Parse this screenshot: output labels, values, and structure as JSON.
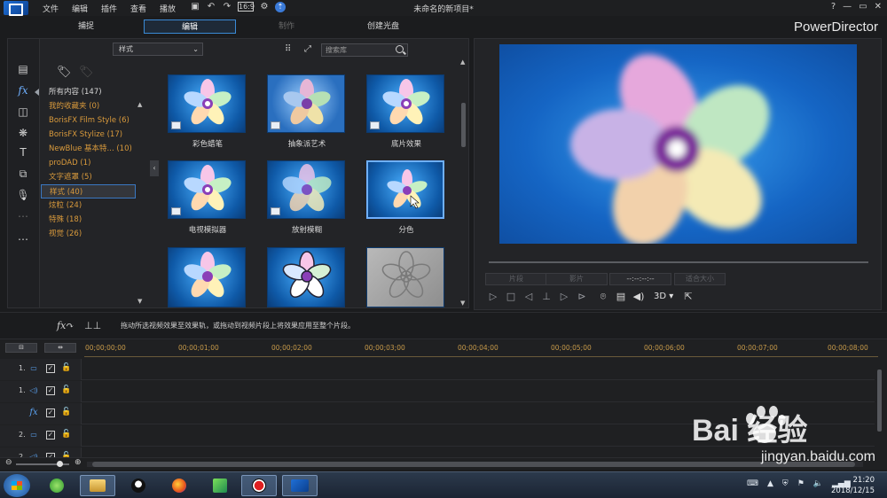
{
  "app": {
    "menu": [
      "文件",
      "编辑",
      "插件",
      "查看",
      "播放"
    ],
    "toolbar_icons": [
      "save-icon",
      "undo-icon",
      "redo-icon",
      "screen-ratio-icon",
      "settings-icon",
      "upgrade-icon"
    ],
    "document_title": "未命名的新项目*",
    "brand": "PowerDirector",
    "window_buttons": [
      "?",
      "—",
      "▭",
      "✕"
    ]
  },
  "modes": [
    {
      "label": "捕捉",
      "state": "normal"
    },
    {
      "label": "编辑",
      "state": "active"
    },
    {
      "label": "制作",
      "state": "disabled"
    },
    {
      "label": "创建光盘",
      "state": "normal"
    }
  ],
  "library": {
    "rail_icons": [
      "media-room-icon",
      "effects-fx-icon",
      "pip-icon",
      "particle-icon",
      "title-icon",
      "transition-icon",
      "audio-mix-icon",
      "chapter-icon",
      "subtitle-icon"
    ],
    "style_dropdown": "样式",
    "search_placeholder": "搜索库",
    "tag_icons": [
      "add-tag-icon",
      "remove-tag-icon"
    ],
    "categories": [
      {
        "label": "所有内容 (147)",
        "kind": "all"
      },
      {
        "label": "我的收藏夹  (0)",
        "kind": "normal"
      },
      {
        "label": "BorisFX Film Style  (6)",
        "kind": "normal"
      },
      {
        "label": "BorisFX Stylize  (17)",
        "kind": "normal"
      },
      {
        "label": "NewBlue 基本特...  (10)",
        "kind": "normal"
      },
      {
        "label": "proDAD  (1)",
        "kind": "normal"
      },
      {
        "label": "文字遮罩  (5)",
        "kind": "normal"
      },
      {
        "label": "样式  (40)",
        "kind": "selected"
      },
      {
        "label": "炫粒  (24)",
        "kind": "normal"
      },
      {
        "label": "特殊  (18)",
        "kind": "normal"
      },
      {
        "label": "视觉  (26)",
        "kind": "normal"
      }
    ],
    "effects": [
      {
        "label": "彩色蜡笔",
        "style": "blue"
      },
      {
        "label": "抽象派艺术",
        "style": "blue"
      },
      {
        "label": "底片效果",
        "style": "blue"
      },
      {
        "label": "电视模拟器",
        "style": "blue"
      },
      {
        "label": "放射模糊",
        "style": "blue"
      },
      {
        "label": "分色",
        "style": "selected"
      },
      {
        "label": "",
        "style": "blue"
      },
      {
        "label": "",
        "style": "blue"
      },
      {
        "label": "",
        "style": "gray"
      }
    ]
  },
  "preview": {
    "buttons": [
      "片段",
      "影片",
      "--:--:--:--",
      "适合大小"
    ],
    "play_icons": [
      "play-icon",
      "stop-icon",
      "prev-frame-icon",
      "split-icon",
      "next-frame-icon",
      "fast-forward-icon",
      "snapshot-icon",
      "subtitle-toggle-icon",
      "volume-icon"
    ],
    "mode_3d": "3D",
    "undock_icon": "undock-icon"
  },
  "hint": {
    "text": "拖动所选视频效果至效果轨，或拖动到视频片段上将效果应用至整个片段。"
  },
  "timeline": {
    "timecodes": [
      "00;00;00;00",
      "00;00;01;00",
      "00;00;02;00",
      "00;00;03;00",
      "00;00;04;00",
      "00;00;05;00",
      "00;00;06;00",
      "00;00;07;00",
      "00;00;08;00"
    ],
    "tracks": [
      {
        "num": "1.",
        "type": "video"
      },
      {
        "num": "1.",
        "type": "audio"
      },
      {
        "num": "",
        "type": "fx"
      },
      {
        "num": "2.",
        "type": "video"
      },
      {
        "num": "2.",
        "type": "audio"
      }
    ]
  },
  "taskbar": {
    "apps": [
      "explorer-app",
      "file-manager-app",
      "qq-app",
      "firefox-app",
      "video-app",
      "record-app",
      "powerdirector-app"
    ],
    "time": "21:20",
    "date": "2018/12/15"
  },
  "watermark": {
    "main": "Bai  经验",
    "sub": "jingyan.baidu.com"
  },
  "colors": {
    "accent": "#3a8ad6",
    "category_orange": "#d99a3c",
    "timecode": "#c79a4a",
    "background": "#1b1c1e"
  }
}
